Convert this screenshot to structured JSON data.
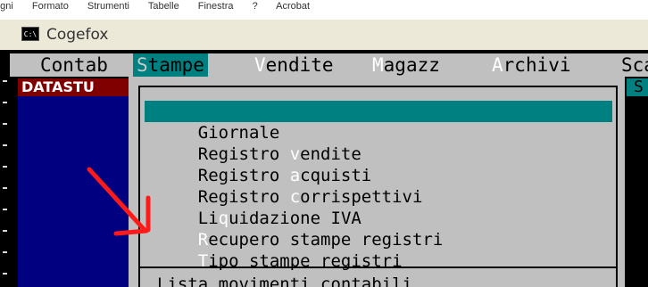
{
  "host_menu": {
    "items": [
      "rigni",
      "Formato",
      "Strumenti",
      "Tabelle",
      "Finestra",
      "?",
      "Acrobat"
    ]
  },
  "window": {
    "icon_label": "C:\\",
    "title": "Cogefox"
  },
  "menubar": {
    "items": [
      {
        "hot": "",
        "rest": "Contab"
      },
      {
        "hot": "S",
        "rest": "tampe"
      },
      {
        "hot": "V",
        "rest": "endite"
      },
      {
        "hot": "M",
        "rest": "agazz"
      },
      {
        "hot": "A",
        "rest": "rchivi"
      },
      {
        "hot": "",
        "rest": "Sca"
      }
    ]
  },
  "panel": {
    "label": "DATASTU",
    "right_chip": "S"
  },
  "dropdown": {
    "items": [
      {
        "pre": "",
        "hot": "",
        "post": "Giornale",
        "selected": true
      },
      {
        "pre": "Registro ",
        "hot": "v",
        "post": "endite",
        "selected": false
      },
      {
        "pre": "Registro ",
        "hot": "a",
        "post": "cquisti",
        "selected": false
      },
      {
        "pre": "Registro ",
        "hot": "c",
        "post": "orrispettivi",
        "selected": false
      },
      {
        "pre": "Li",
        "hot": "q",
        "post": "uidazione IVA",
        "selected": false
      },
      {
        "pre": "",
        "hot": "R",
        "post": "ecupero stampe registri",
        "selected": false
      },
      {
        "pre": "",
        "hot": "T",
        "post": "ipo stampe registri",
        "selected": false
      }
    ],
    "next_section": "Lista movimenti contabili"
  },
  "colors": {
    "console_bg": "#000000",
    "menu_bg": "#c0c0c0",
    "selection": "#008080",
    "panel_red": "#800000",
    "panel_blue": "#000080",
    "arrow": "#ff1a1a"
  },
  "icons": {
    "window_icon": "console-window-icon",
    "annotation": "red-arrow-icon"
  }
}
